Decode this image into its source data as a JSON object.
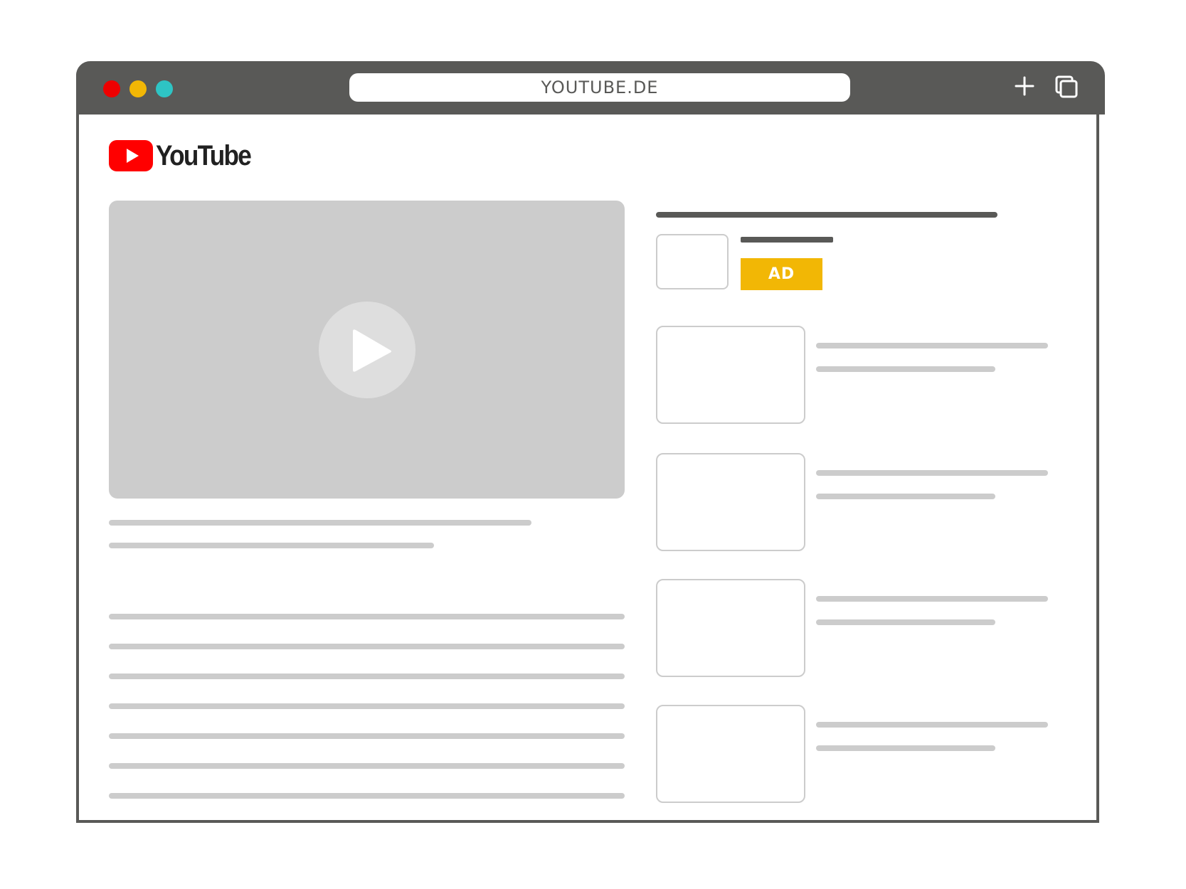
{
  "browser": {
    "url": "YOUTUBE.DE",
    "icons": {
      "close": "red-dot",
      "minimize": "yellow-dot",
      "maximize": "teal-dot",
      "new_tab": "plus-icon",
      "tabs": "tabs-icon"
    },
    "colors": {
      "frame": "#595957",
      "close": "#ee0000",
      "minimize": "#f2b705",
      "maximize": "#2ec4c4"
    }
  },
  "logo": {
    "text": "YouTube",
    "mark_color": "#ff0000"
  },
  "player": {
    "icon": "play-icon"
  },
  "sidebar": {
    "ad_label": "AD",
    "ad_color": "#f2b705"
  }
}
